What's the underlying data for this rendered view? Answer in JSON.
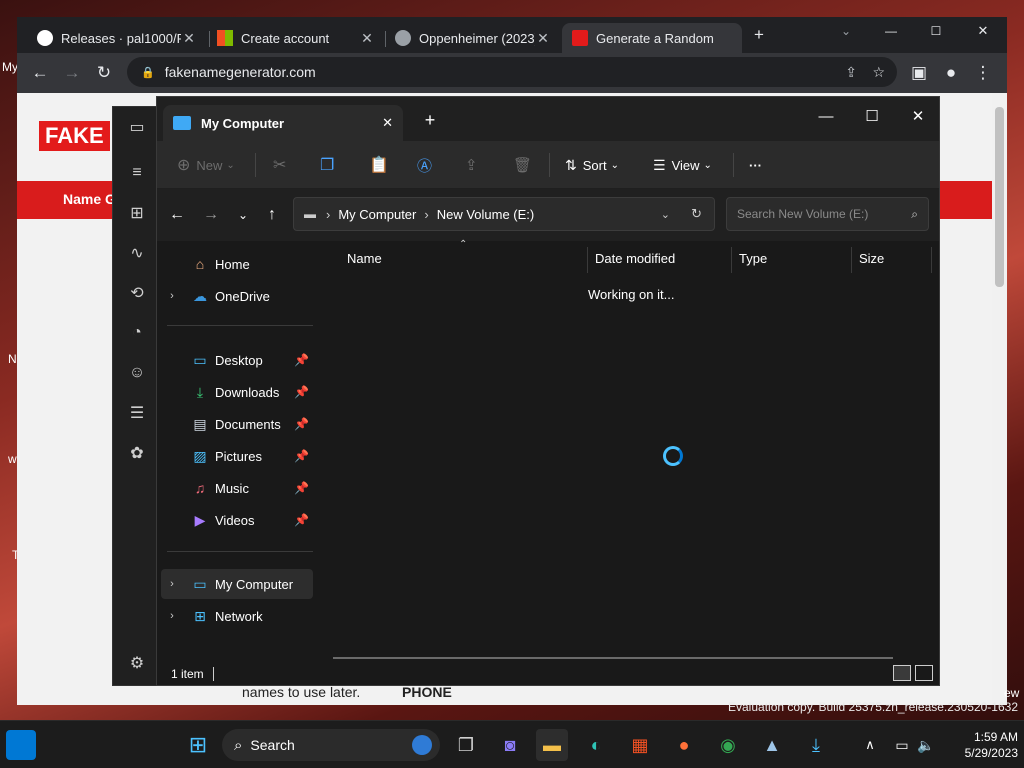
{
  "desktop": {
    "left_fragments": [
      "My",
      "N",
      "w",
      "T"
    ],
    "watermark": "Evaluation copy. Build 25375.zn_release.230520-1632",
    "right_fragment": "ew"
  },
  "browser": {
    "tabs": [
      {
        "label": "Releases · pal1000/Re",
        "icon": "github-icon"
      },
      {
        "label": "Create account",
        "icon": "microsoft-icon"
      },
      {
        "label": "Oppenheimer (2023)",
        "icon": "globe-icon"
      },
      {
        "label": "Generate a Random",
        "icon": "fakename-favicon"
      }
    ],
    "url": "fakenamegenerator.com",
    "page": {
      "logo": "FAKE",
      "nav_label": "Name G",
      "bottom_text_left": "names to use later.",
      "bottom_text_right": "PHONE"
    }
  },
  "explorer": {
    "tab_title": "My Computer",
    "commands": {
      "new": "New",
      "sort": "Sort",
      "view": "View",
      "more": "···"
    },
    "breadcrumb": [
      "My Computer",
      "New Volume (E:)"
    ],
    "search_placeholder": "Search New Volume (E:)",
    "nav": {
      "home": "Home",
      "onedrive": "OneDrive",
      "desktop": "Desktop",
      "downloads": "Downloads",
      "documents": "Documents",
      "pictures": "Pictures",
      "music": "Music",
      "videos": "Videos",
      "my_computer": "My Computer",
      "network": "Network"
    },
    "columns": [
      "Name",
      "Date modified",
      "Type",
      "Size"
    ],
    "working_text": "Working on it...",
    "status": "1 item"
  },
  "taskbar": {
    "search_label": "Search",
    "time": "1:59 AM",
    "date": "5/29/2023"
  }
}
